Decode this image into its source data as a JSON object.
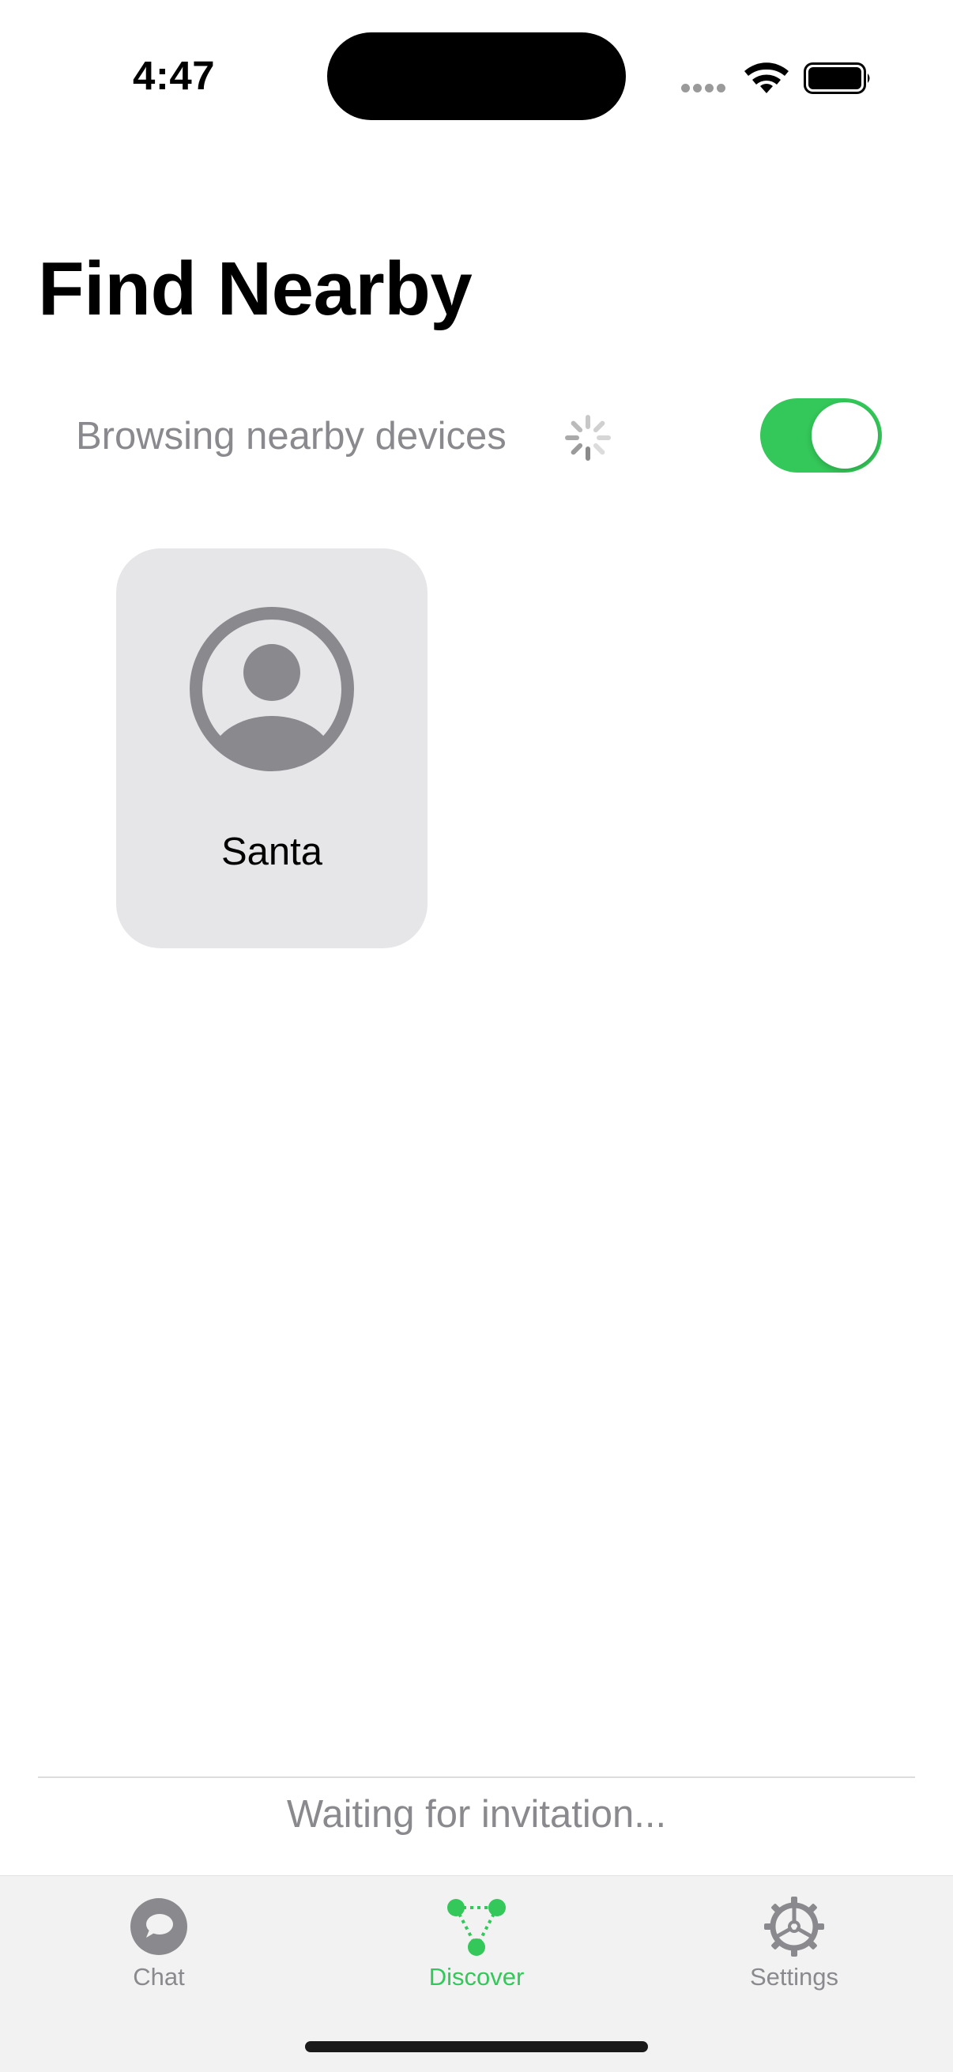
{
  "status_bar": {
    "time": "4:47",
    "icons": [
      "cellular-signal-icon",
      "wifi-icon",
      "battery-icon"
    ]
  },
  "page": {
    "title": "Find Nearby"
  },
  "browse": {
    "label": "Browsing nearby devices",
    "toggle_on": true,
    "icons": [
      "spinner-icon"
    ]
  },
  "peers": [
    {
      "name": "Santa",
      "icon": "person-circle-icon"
    }
  ],
  "footer": {
    "status_text": "Waiting for invitation..."
  },
  "tab_bar": {
    "tabs": [
      {
        "label": "Chat",
        "icon": "chat-bubble-icon",
        "active": false
      },
      {
        "label": "Discover",
        "icon": "network-nodes-icon",
        "active": true
      },
      {
        "label": "Settings",
        "icon": "gear-icon",
        "active": false
      }
    ]
  },
  "colors": {
    "accent": "#34c759",
    "secondary_text": "#8a8a8e",
    "card_background": "#e6e6e9",
    "tab_bar_background": "#f2f2f2",
    "avatar_gray": "#8a8a8e"
  }
}
